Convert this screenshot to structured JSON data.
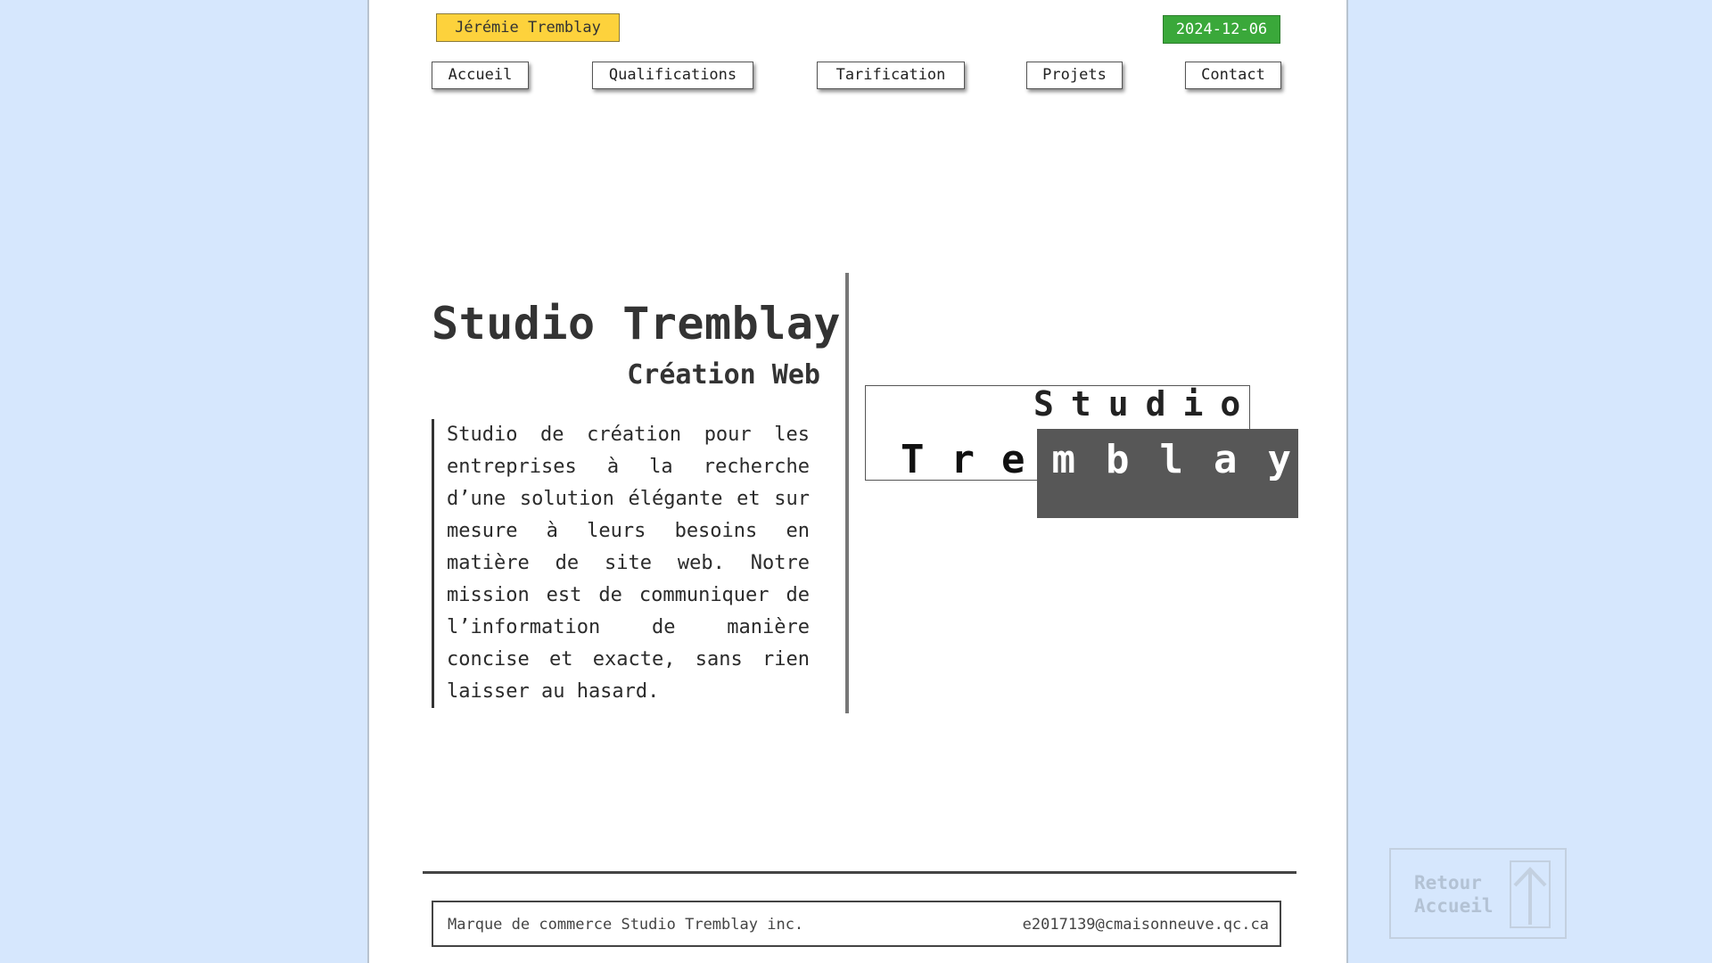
{
  "header": {
    "name": "Jérémie Tremblay",
    "date": "2024-12-06"
  },
  "nav": {
    "items": [
      {
        "label": "Accueil"
      },
      {
        "label": "Qualifications"
      },
      {
        "label": "Tarification"
      },
      {
        "label": "Projets"
      },
      {
        "label": "Contact"
      }
    ]
  },
  "hero": {
    "title": "Studio Tremblay",
    "subtitle": "Création Web",
    "description": "Studio de création pour les entreprises à la recherche d’une solution élégante et sur mesure à leurs besoins en matière de site web. Notre mission est de communiquer de l’information de manière concise et exacte, sans rien laisser au hasard."
  },
  "logo": {
    "word1": "Studio",
    "word2_dark": "Tre",
    "word2_light": "mbla",
    "word2_end": "y"
  },
  "footer": {
    "trademark": "Marque de commerce Studio Tremblay inc.",
    "email": "e2017139@cmaisonneuve.qc.ca"
  },
  "back_to_top": {
    "label": "Retour\nAccueil",
    "icon": "arrow-up-icon"
  },
  "colors": {
    "background": "#d6e7fd",
    "name_badge": "#fdd23c",
    "date_badge": "#3aa83a",
    "logo_dark": "#575757"
  }
}
